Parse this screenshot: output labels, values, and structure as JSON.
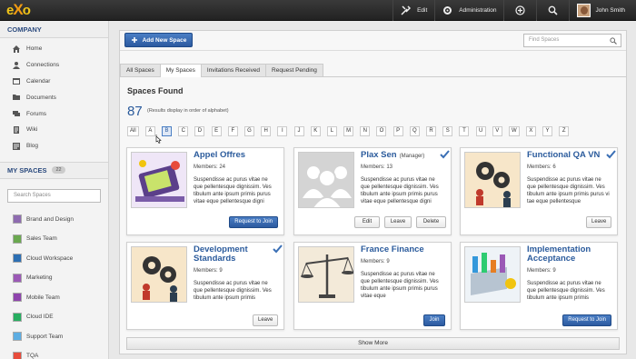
{
  "topbar": {
    "logo": {
      "e": "e",
      "x": "X",
      "o": "o"
    },
    "edit": "Edit",
    "administration": "Administration",
    "user_name": "John Smith"
  },
  "sidebar": {
    "company_title": "COMPANY",
    "nav": [
      {
        "label": "Home",
        "icon": "home-icon"
      },
      {
        "label": "Connections",
        "icon": "person-icon"
      },
      {
        "label": "Calendar",
        "icon": "calendar-icon"
      },
      {
        "label": "Documents",
        "icon": "folder-icon"
      },
      {
        "label": "Forums",
        "icon": "forum-icon"
      },
      {
        "label": "Wiki",
        "icon": "wiki-icon"
      },
      {
        "label": "Blog",
        "icon": "blog-icon"
      }
    ],
    "myspaces_title": "MY SPACES",
    "myspaces_count": "22",
    "search_placeholder": "Search Spaces",
    "spaces": [
      {
        "label": "Brand and Design",
        "color": "#8e6bb0"
      },
      {
        "label": "Sales Team",
        "color": "#6aa84f"
      },
      {
        "label": "Cloud Workspace",
        "color": "#2c6fb3"
      },
      {
        "label": "Marketing",
        "color": "#9b59b6"
      },
      {
        "label": "Mobile Team",
        "color": "#8e44ad"
      },
      {
        "label": "Cloud IDE",
        "color": "#27ae60"
      },
      {
        "label": "Support Team",
        "color": "#5dade2"
      },
      {
        "label": "TQA",
        "color": "#e74c3c"
      }
    ]
  },
  "main": {
    "add_button": "Add New Space",
    "find_placeholder": "Find Spaces",
    "tabs": [
      "All Spaces",
      "My Spaces",
      "Invitations Received",
      "Request Pending"
    ],
    "found_title": "Spaces Found",
    "count": "87",
    "count_note": "(Results display in order of alphabet)",
    "alphabet": [
      "All",
      "A",
      "B",
      "C",
      "D",
      "E",
      "F",
      "G",
      "H",
      "I",
      "J",
      "K",
      "L",
      "M",
      "N",
      "O",
      "P",
      "Q",
      "R",
      "S",
      "T",
      "U",
      "V",
      "W",
      "X",
      "Y",
      "Z"
    ],
    "show_more": "Show More",
    "cards": [
      {
        "name": "Appel Offres",
        "role": "",
        "members": "Members: 24",
        "desc": "Suspendisse ac purus vitae ne que pellentesque dignissim. Ves tibulum ante ipsum primis purus vitae eque pellentesque digni",
        "buttons": [
          "Request to Join"
        ]
      },
      {
        "name": "Plax Sen",
        "role": "(Manager)",
        "members": "Members: 13",
        "desc": "Suspendisse ac purus vitae ne que pellentesque dignissim. Ves tibulum ante ipsum primis purus vitae eque pellentesque digni",
        "buttons": [
          "Edit",
          "Leave",
          "Delete"
        ]
      },
      {
        "name": "Functional QA VN",
        "role": "",
        "members": "Members: 6",
        "desc": "Suspendisse ac purus vitae ne que pellentesque dignissim. Ves tibulum ante ipsum primis purus vi tae eque pellentesque",
        "buttons": [
          "Leave"
        ]
      },
      {
        "name": "Development Standards",
        "role": "",
        "members": "Members: 9",
        "desc": "Suspendisse ac purus vitae ne que pellentesque dignissim. Ves tibulum ante ipsum primis",
        "buttons": [
          "Leave"
        ]
      },
      {
        "name": "France Finance",
        "role": "",
        "members": "Members: 9",
        "desc": "Suspendisse ac purus vitae ne que pellentesque dignissim. Ves tibulum ante ipsum primis purus vitae eque",
        "buttons": [
          "Join"
        ]
      },
      {
        "name": "Implementation Acceptance",
        "role": "",
        "members": "Members: 9",
        "desc": "Suspendisse ac purus vitae ne que pellentesque dignissim. Ves tibulum ante ipsum primis",
        "buttons": [
          "Request to Join"
        ]
      }
    ]
  }
}
